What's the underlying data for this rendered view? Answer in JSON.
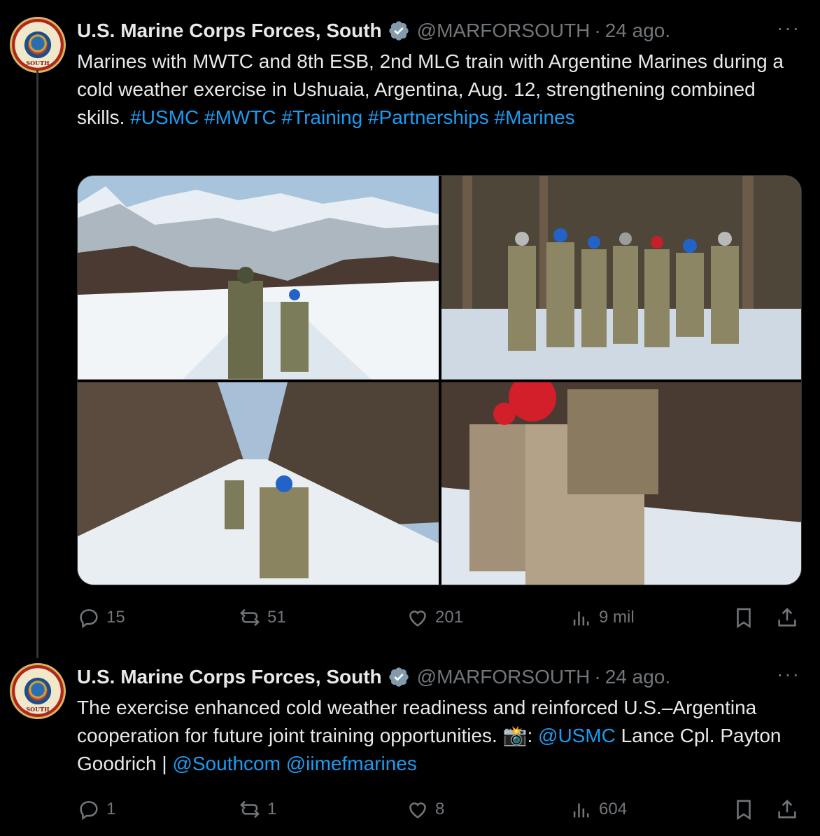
{
  "tweets": [
    {
      "author": {
        "name": "U.S. Marine Corps Forces, South",
        "handle": "@MARFORSOUTH",
        "time": "24 ago.",
        "avatar_text": "SOUTH"
      },
      "text_parts": {
        "body": "Marines with MWTC and 8th ESB, 2nd MLG train with Argentine Marines during a cold weather exercise in Ushuaia, Argentina, Aug. 12, strengthening combined skills.",
        "tags": [
          "#USMC",
          "#MWTC",
          "#Training",
          "#Partnerships",
          "#Marines"
        ]
      },
      "stats": {
        "replies": "15",
        "reposts": "51",
        "likes": "201",
        "views": "9 mil"
      }
    },
    {
      "author": {
        "name": "U.S. Marine Corps Forces, South",
        "handle": "@MARFORSOUTH",
        "time": "24 ago.",
        "avatar_text": "SOUTH"
      },
      "text_parts": {
        "body": "The exercise enhanced cold weather readiness and reinforced U.S.–Argentina cooperation for future joint training opportunities. 📸:",
        "mention1": "@USMC",
        "body2": "Lance Cpl. Payton Goodrich |",
        "mention2": "@Southcom",
        "mention3": "@iimefmarines"
      },
      "stats": {
        "replies": "1",
        "reposts": "1",
        "likes": "8",
        "views": "604"
      }
    }
  ],
  "ui": {
    "more": "···",
    "dot": "·"
  },
  "colors": {
    "link": "#1d9bf0",
    "muted": "#71767b",
    "verified": "#829aab"
  }
}
